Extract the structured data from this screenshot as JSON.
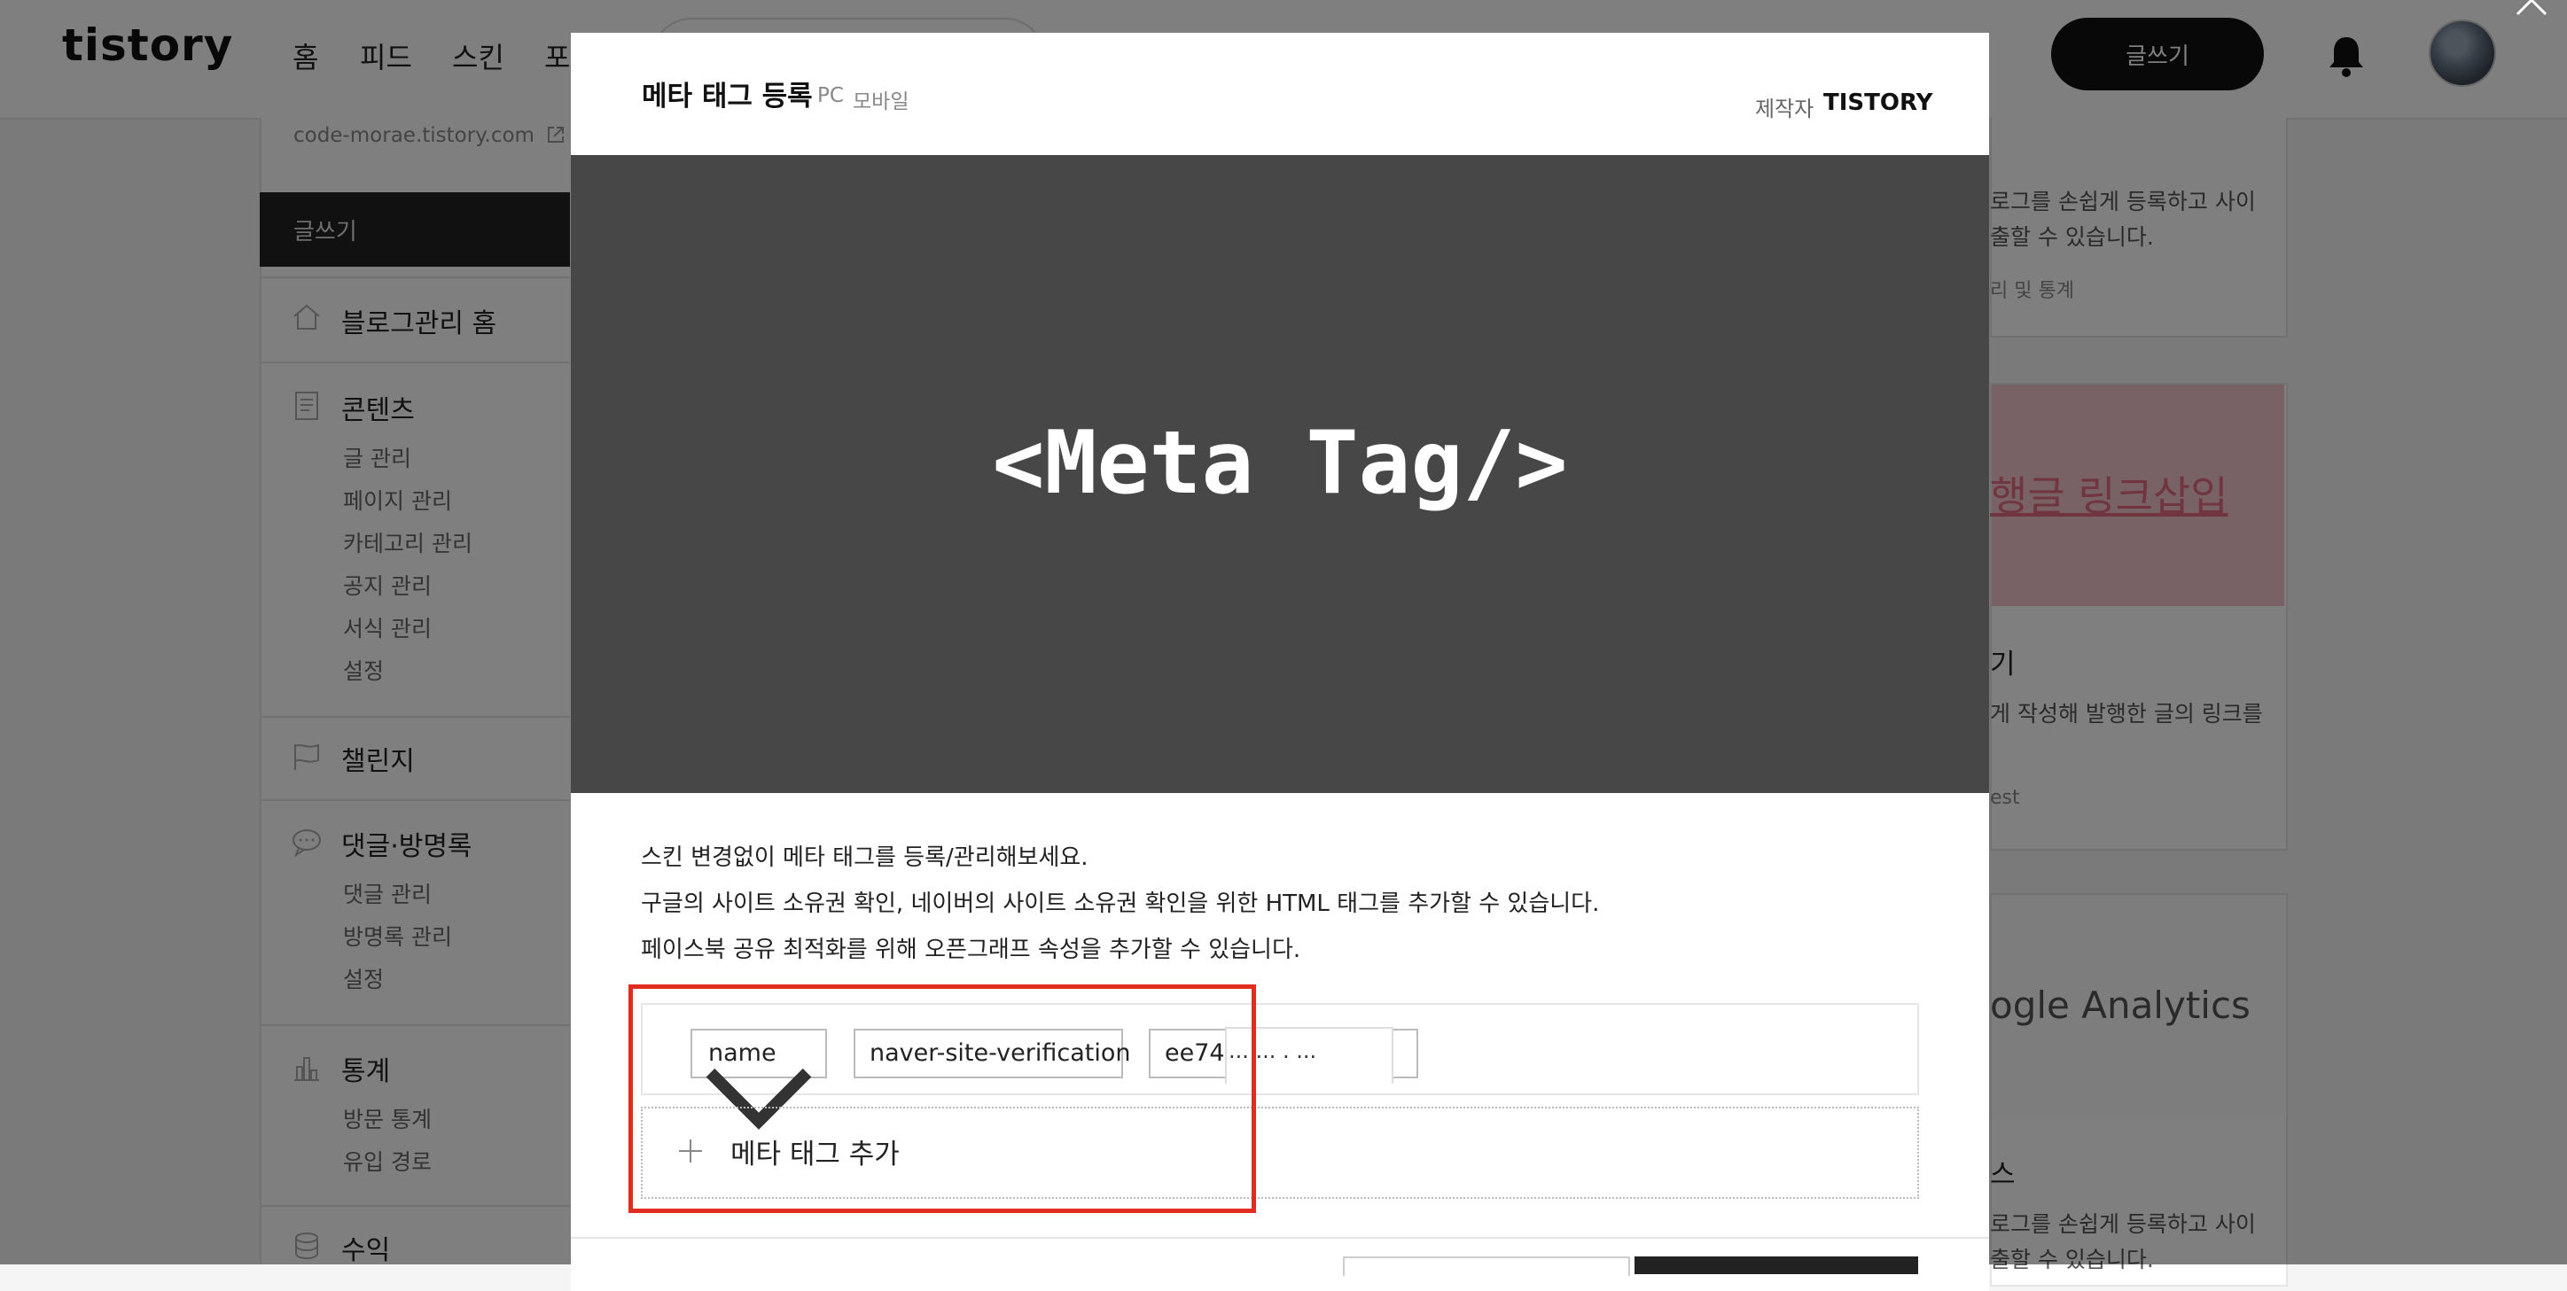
{
  "header": {
    "logo": "tistory",
    "nav": [
      "홈",
      "피드",
      "스킨",
      "포"
    ],
    "write_button": "글쓰기"
  },
  "sidebar": {
    "blog_url": "code-morae.tistory.com",
    "write_label": "글쓰기",
    "sections": [
      {
        "title": "블로그관리 홈",
        "items": []
      },
      {
        "title": "콘텐츠",
        "items": [
          "글 관리",
          "페이지 관리",
          "카테고리 관리",
          "공지 관리",
          "서식 관리",
          "설정"
        ]
      },
      {
        "title": "챌린지",
        "items": []
      },
      {
        "title": "댓글·방명록",
        "items": [
          "댓글 관리",
          "방명록 관리",
          "설정"
        ]
      },
      {
        "title": "통계",
        "items": [
          "방문 통계",
          "유입 경로"
        ]
      },
      {
        "title": "수익",
        "items": []
      }
    ]
  },
  "right_panel": {
    "card1_line1": "로그를 손쉽게 등록하고 사이",
    "card1_line2": "출할 수 있습니다.",
    "card1_link": "리 및 통계",
    "card2_banner": "행글 링크삽입",
    "card2_title": "기",
    "card2_line1": "게 작성해 발행한 글의 링크를",
    "card2_line2": "est",
    "card3_banner": "ogle Analytics",
    "card3_title": "스",
    "card3_line1": "로그를 손쉽게 등록하고 사이",
    "card3_line2": "출할 수 있습니다."
  },
  "modal": {
    "title": "메타 태그 등록",
    "device_pc": "PC",
    "device_mobile": "모바일",
    "author_label": "제작자",
    "author_name": "TISTORY",
    "preview_text": "<Meta Tag/>",
    "descriptions": [
      "스킨 변경없이 메타 태그를 등록/관리해보세요.",
      "구글의 사이트 소유권 확인, 네이버의 사이트 소유권 확인을 위한 HTML 태그를 추가할 수 있습니다.",
      "페이스북 공유 최적화를 위해 오픈그래프 속성을 추가할 수 있습니다."
    ],
    "tag_row": {
      "attribute": "name",
      "name_value": "naver-site-verification",
      "content_value": "ee74",
      "content_masked": "··· ··· · ···"
    },
    "add_label": "메타 태그 추가"
  },
  "colors": {
    "highlight": "#e12d1f",
    "preview_bg": "#474747",
    "dark_button": "#111111",
    "pink_banner": "#f3c5cc"
  }
}
